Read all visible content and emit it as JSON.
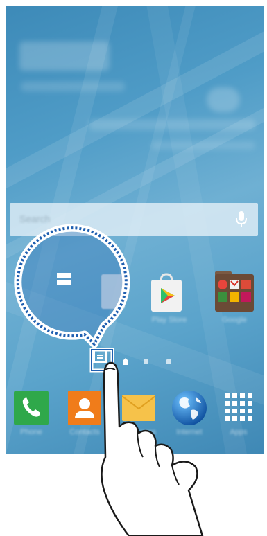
{
  "screen": {
    "search": {
      "placeholder": "Search"
    },
    "apps_row": [
      {
        "name": "Play Store"
      },
      {
        "name": "Google"
      }
    ],
    "page_indicator": {
      "selected": "page-overview",
      "pages": [
        "page-overview",
        "home",
        "page-2",
        "page-3"
      ]
    },
    "dock": [
      {
        "name": "Phone"
      },
      {
        "name": "Contacts"
      },
      {
        "name": "Messages"
      },
      {
        "name": "Internet"
      },
      {
        "name": "Apps"
      }
    ]
  },
  "colors": {
    "accent": "#1b6fc9",
    "phone_green": "#2fa84a",
    "contacts_orange": "#f07c1a",
    "highlight_blue": "#1f5fb0"
  }
}
